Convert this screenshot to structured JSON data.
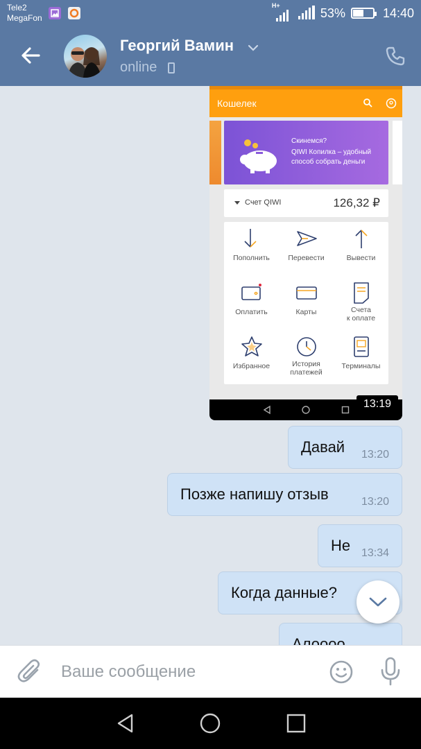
{
  "status_bar": {
    "carrier_1": "Tele2",
    "carrier_2": "MegaFon",
    "network_type": "H+",
    "battery_percent": "53%",
    "battery_level": 0.53,
    "time": "14:40",
    "app_icons": [
      "gallery-icon",
      "browser-icon"
    ]
  },
  "header": {
    "contact_name": "Георгий Вамин",
    "status": "online",
    "icons": [
      "back-arrow-icon",
      "chevron-down-icon",
      "mobile-device-icon",
      "phone-call-icon"
    ],
    "color": "#5a79a3"
  },
  "screenshot_message": {
    "time": "13:19",
    "app": {
      "title": "Кошелек",
      "accent_color": "#ff9f0e",
      "banner": {
        "title": "Скинемся?",
        "text": "QIWI Копилка – удобный способ собрать деньги",
        "color": "#8a5adb"
      },
      "account": {
        "label": "Счет QIWI",
        "amount": "126,32 ₽"
      },
      "tiles": [
        {
          "label": "Пополнить",
          "icon": "arrow-down-icon"
        },
        {
          "label": "Перевести",
          "icon": "send-icon"
        },
        {
          "label": "Вывести",
          "icon": "arrow-up-icon"
        },
        {
          "label": "Оплатить",
          "icon": "wallet-icon"
        },
        {
          "label": "Карты",
          "icon": "card-icon"
        },
        {
          "label_line1": "Счета",
          "label_line2": "к оплате",
          "icon": "invoice-icon"
        },
        {
          "label": "Избранное",
          "icon": "star-icon"
        },
        {
          "label_line1": "История",
          "label_line2": "платежей",
          "icon": "clock-icon"
        },
        {
          "label": "Терминалы",
          "icon": "terminal-icon"
        }
      ]
    }
  },
  "messages": [
    {
      "text": "Давай",
      "time": "13:20"
    },
    {
      "text": "Позже напишу отзыв",
      "time": "13:20"
    },
    {
      "text": "Не",
      "time": "13:34"
    },
    {
      "text": "Когда данные?",
      "time": ""
    },
    {
      "text": "Алоооо",
      "time": ""
    }
  ],
  "input": {
    "placeholder": "Ваше сообщение",
    "value": ""
  },
  "colors": {
    "bubble": "#cfe2f6",
    "chat_background": "#dfe5ec"
  }
}
